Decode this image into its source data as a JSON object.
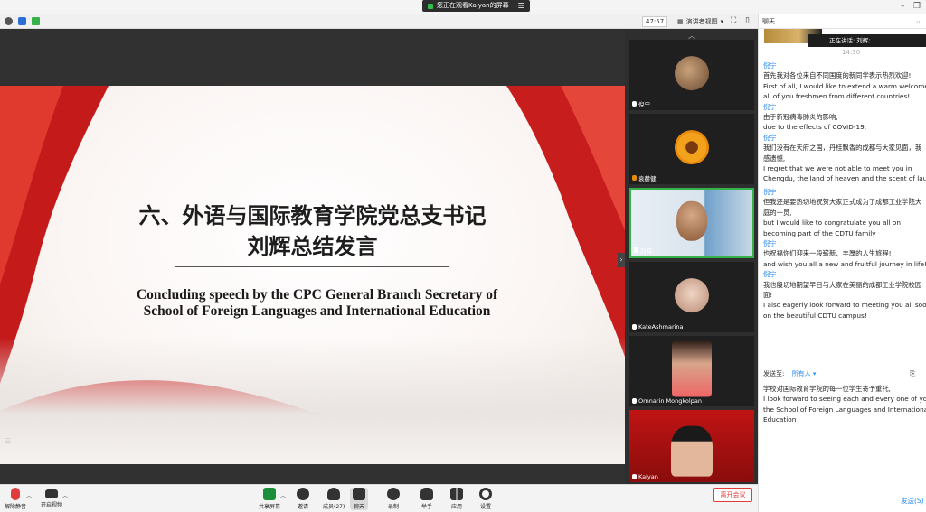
{
  "topbar": {
    "share_label": "您正在观看Kaiyan的屏幕"
  },
  "meeting": {
    "timer": "47:57",
    "view_mode": "演讲者视图"
  },
  "slide": {
    "title_line1": "六、外语与国际教育学院党总支书记",
    "title_line2": "刘辉总结发言",
    "en_line1": "Concluding speech by    the CPC General Branch Secretary of",
    "en_line2": "School of Foreign Languages and International Education"
  },
  "participants": [
    {
      "name": "倪宁"
    },
    {
      "name": "袁赫健"
    },
    {
      "name": "刘辉"
    },
    {
      "name": "KateAshmarina"
    },
    {
      "name": "Ornnarin Mongkolpan"
    },
    {
      "name": "Kaiyan"
    }
  ],
  "chat": {
    "header": "聊天",
    "speaking": "正在讲话: 刘辉;",
    "time": "14:30",
    "messages": [
      {
        "sender": "倪宁",
        "lines": [
          "首先我对各位来自不同国度的新同学表示热烈欢迎!",
          "First of all, I would like to extend a warm welcome",
          "all of you freshmen from different countries!"
        ]
      },
      {
        "sender": "倪宁",
        "lines": [
          "由于新冠病毒肺炎的影响,",
          "due to the effects of COVID-19,"
        ]
      },
      {
        "sender": "倪宁",
        "lines": [
          "我们没有在天府之国，丹桂飘香的成都与大家见面，我",
          "感遗憾,",
          "I regret that we were not able to meet you in",
          "Chengdu, the land of heaven and the scent of lau"
        ]
      },
      {
        "sender": "倪宁",
        "lines": [
          "但我还是要热切地祝贺大家正式成为了成都工业学院大",
          "庭的一员,",
          "but I would like to congratulate you all on",
          "becoming part of the CDTU family"
        ]
      },
      {
        "sender": "倪宁",
        "lines": [
          "也祝福你们迎来一段崭新、丰厚的人生旅程!",
          "and wish you all a new and fruitful journey in life!"
        ]
      },
      {
        "sender": "倪宁",
        "lines": [
          "我也殷切地期望早日与大家在美丽的成都工业学院校园",
          "面!",
          "I also eagerly look forward to meeting you all soo",
          "on the beautiful CDTU campus!"
        ]
      }
    ],
    "send_to_label": "发送至:",
    "send_to_value": "所有人",
    "draft_lines": [
      "学校对国际教育学院的每一位学生寄予重托,",
      "I look forward to seeing each and every one of yo",
      "the School of Foreign Languages and Internationa",
      "Education"
    ],
    "send_button": "发送(S)"
  },
  "controls": {
    "mute": "解除静音",
    "video": "开启视频",
    "share": "共享屏幕",
    "invite": "邀请",
    "members": "成员(27)",
    "chat": "聊天",
    "record": "录制",
    "raise_hand": "举手",
    "apps": "应用",
    "settings": "设置",
    "leave": "离开会议"
  }
}
